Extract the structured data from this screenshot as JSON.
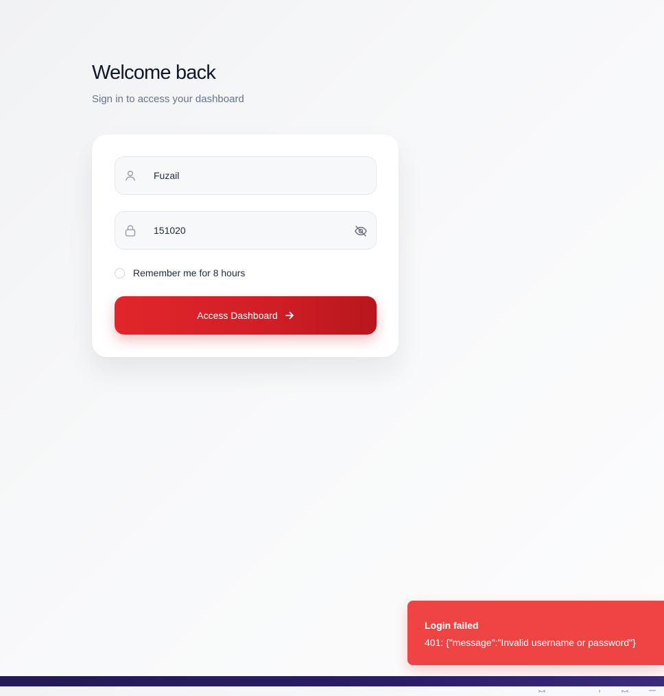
{
  "login": {
    "title": "Welcome back",
    "subtitle": "Sign in to access your dashboard",
    "username": {
      "value": "Fuzail",
      "icon": "user-icon"
    },
    "password": {
      "value": "151020",
      "icon": "lock-icon",
      "toggle_icon": "eye-off-icon"
    },
    "remember_label": "Remember me for 8 hours",
    "remember_checked": false,
    "submit_label": "Access Dashboard",
    "submit_icon": "arrow-right-icon",
    "accent_color": "#dc2626"
  },
  "toast": {
    "title": "Login failed",
    "message": "401: {\"message\":\"Invalid username or password\"}",
    "color": "#ef4444"
  },
  "footer_bar": {
    "color": "#2a1d66"
  }
}
